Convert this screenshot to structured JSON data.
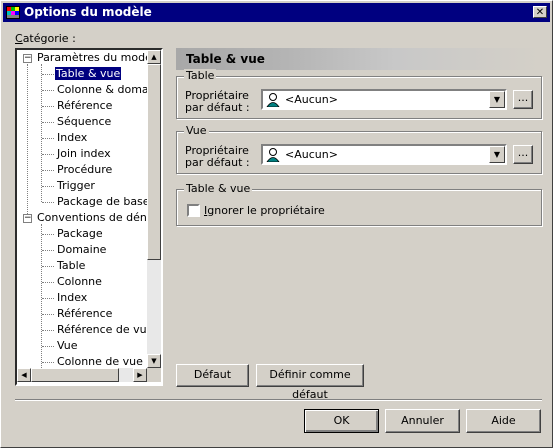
{
  "window": {
    "title": "Options du modèle",
    "close_glyph": "✕"
  },
  "categorie": {
    "label_first": "C",
    "label_rest": "atégorie :"
  },
  "tree": {
    "group1": {
      "label": "Paramètres du modèle",
      "expander": "−"
    },
    "group1_items": [
      "Table & vue",
      "Colonne & domaine",
      "Référence",
      "Séquence",
      "Index",
      "Join index",
      "Procédure",
      "Trigger",
      "Package de base de"
    ],
    "group2": {
      "label": "Conventions de dénomination",
      "expander": "−"
    },
    "group2_items": [
      "Package",
      "Domaine",
      "Table",
      "Colonne",
      "Index",
      "Référence",
      "Référence de vue",
      "Vue",
      "Colonne de vue"
    ],
    "selected": "Table & vue"
  },
  "panel": {
    "header": "Table & vue",
    "table_group": {
      "title": "Table",
      "owner_label_line1": "Propriétaire",
      "owner_label_line2": "par défaut :",
      "owner_value": "<Aucun>",
      "more_button": "..."
    },
    "vue_group": {
      "title": "Vue",
      "owner_label_line1": "Propriétaire",
      "owner_label_line2": "par défaut :",
      "owner_value": "<Aucun>",
      "more_button": "..."
    },
    "tv_group": {
      "title": "Table & vue",
      "ignore_owner_first": "I",
      "ignore_owner_rest": "gnorer le propriétaire",
      "ignore_owner_checked": false
    }
  },
  "buttons": {
    "default": "Défaut",
    "set_default": "Définir comme défaut",
    "ok": "OK",
    "cancel": "Annuler",
    "help": "Aide"
  }
}
